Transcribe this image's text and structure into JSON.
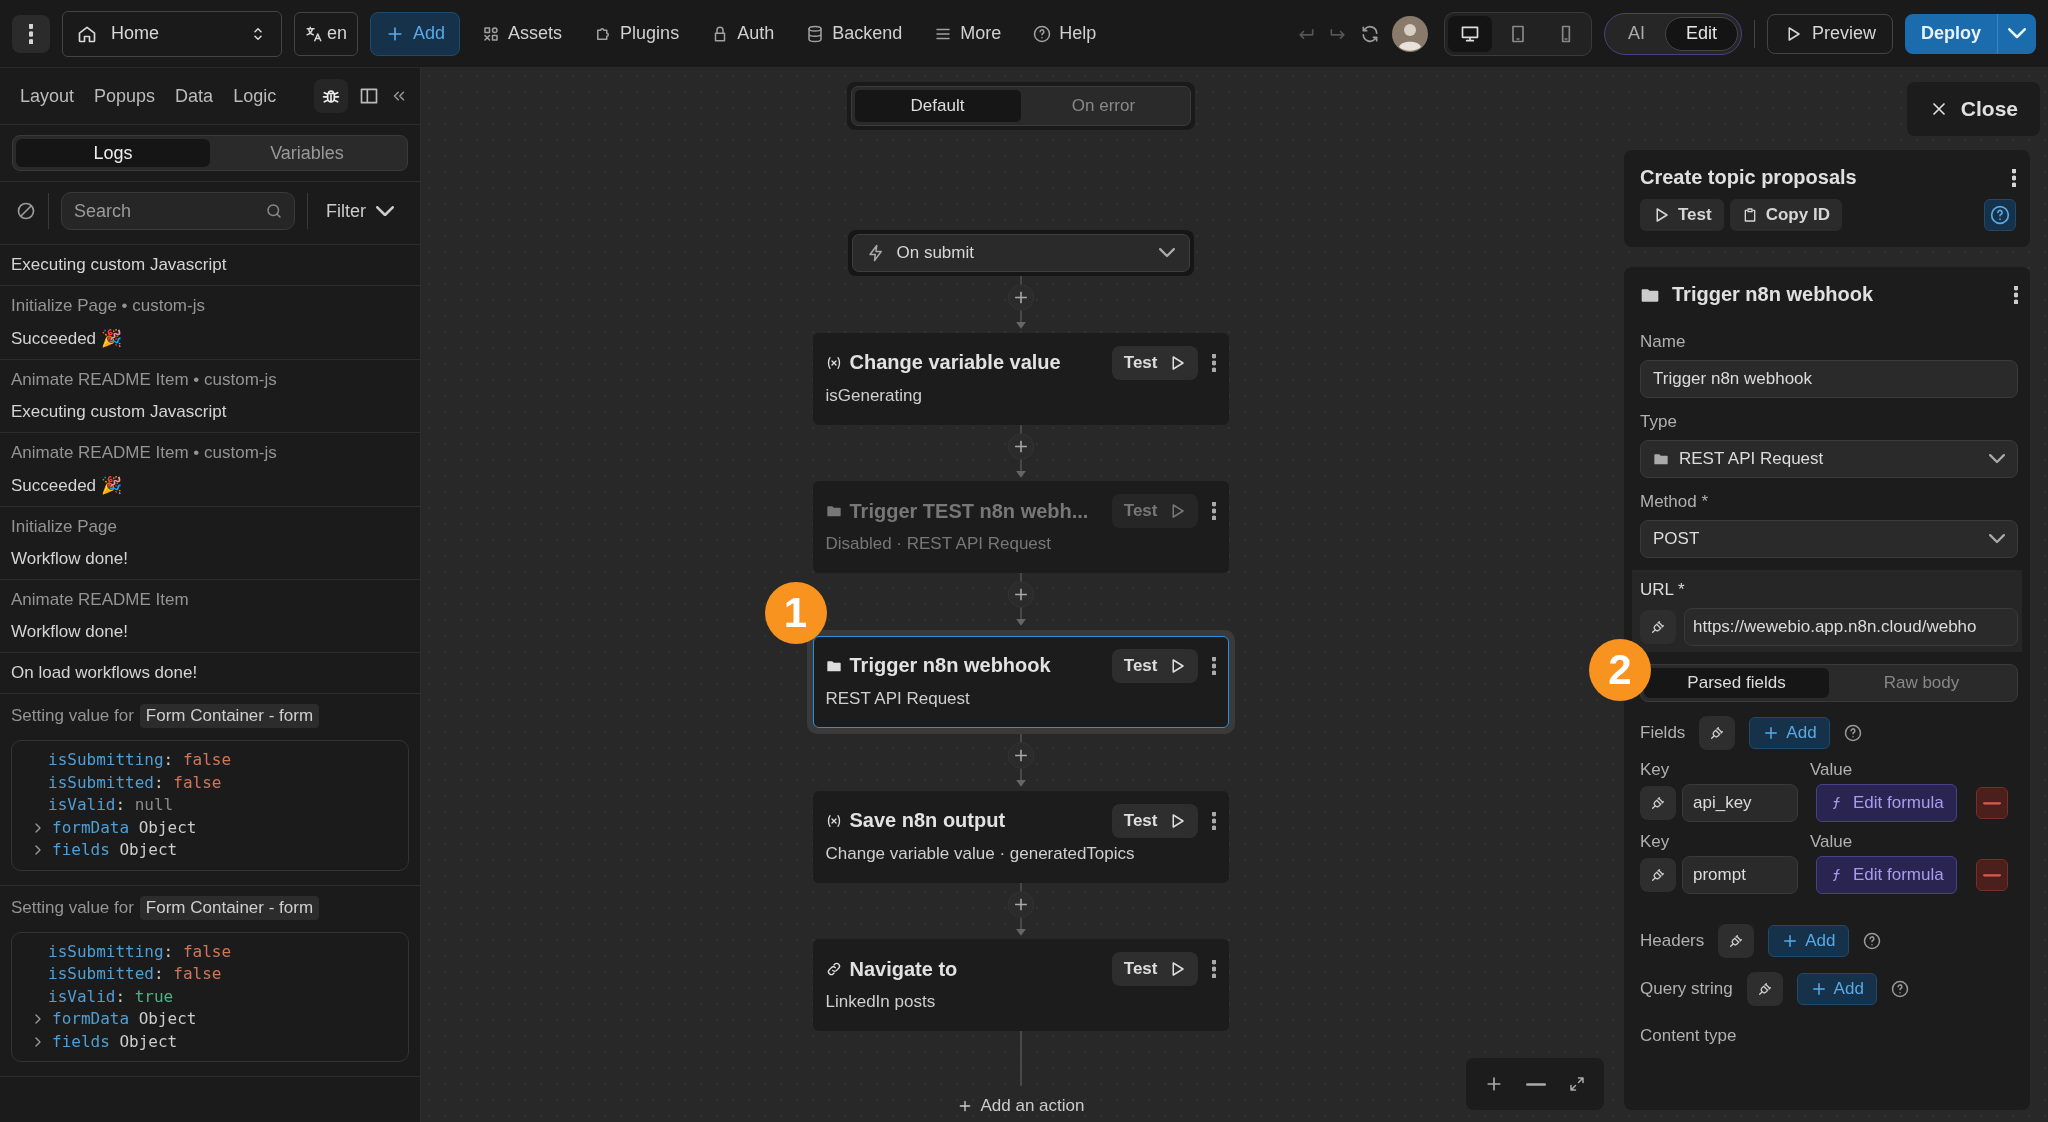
{
  "topbar": {
    "page": "Home",
    "language": "en",
    "add": "Add",
    "nav": [
      {
        "kind": "assets",
        "label": "Assets"
      },
      {
        "kind": "plugins",
        "label": "Plugins"
      },
      {
        "kind": "auth",
        "label": "Auth"
      },
      {
        "kind": "backend",
        "label": "Backend"
      },
      {
        "kind": "more",
        "label": "More"
      },
      {
        "kind": "help",
        "label": "Help"
      }
    ],
    "devices": [
      {
        "kind": "desktop",
        "selected": true
      },
      {
        "kind": "tablet",
        "selected": false
      },
      {
        "kind": "phone",
        "selected": false
      }
    ],
    "modes": [
      {
        "label": "AI",
        "selected": false
      },
      {
        "label": "Edit",
        "selected": true
      }
    ],
    "preview": "Preview",
    "deploy": "Deploy"
  },
  "left_panel": {
    "tabs": [
      "Layout",
      "Popups",
      "Data",
      "Logic"
    ],
    "tools": [
      {
        "kind": "debug",
        "selected": true
      },
      {
        "kind": "sidebar",
        "selected": false
      }
    ],
    "views": [
      {
        "label": "Logs",
        "selected": true
      },
      {
        "label": "Variables",
        "selected": false
      }
    ],
    "search": {
      "placeholder": "Search"
    },
    "filter": "Filter",
    "logs": [
      {
        "kind": "message",
        "message": "Executing custom Javascript"
      },
      {
        "kind": "message",
        "source": "Initialize Page • custom-js",
        "message": "Succeeded 🎉"
      },
      {
        "kind": "message",
        "source": "Animate README Item • custom-js",
        "message": "Executing custom Javascript"
      },
      {
        "kind": "message",
        "source": "Animate README Item • custom-js",
        "message": "Succeeded 🎉"
      },
      {
        "kind": "message",
        "source": "Initialize Page",
        "message": "Workflow done!"
      },
      {
        "kind": "message",
        "source": "Animate README Item",
        "message": "Workflow done!"
      },
      {
        "kind": "message",
        "message": "On load workflows done!"
      },
      {
        "kind": "value",
        "label": "Setting value for",
        "tag": "Form Container - form",
        "lines": [
          {
            "kind": "prop",
            "key": "isSubmitting",
            "sep": ":",
            "value": "false",
            "color": "#d0765b"
          },
          {
            "kind": "prop",
            "key": "isSubmitted",
            "sep": ":",
            "value": "false",
            "color": "#d0765b"
          },
          {
            "kind": "prop",
            "key": "isValid",
            "sep": ":",
            "value": "null",
            "color": "#8a8a8a"
          },
          {
            "kind": "object",
            "key": "formData",
            "value": "Object"
          },
          {
            "kind": "object",
            "key": "fields",
            "value": "Object"
          }
        ]
      },
      {
        "kind": "value",
        "label": "Setting value for",
        "tag": "Form Container - form",
        "lines": [
          {
            "kind": "prop",
            "key": "isSubmitting",
            "sep": ":",
            "value": "false",
            "color": "#d0765b"
          },
          {
            "kind": "prop",
            "key": "isSubmitted",
            "sep": ":",
            "value": "false",
            "color": "#d0765b"
          },
          {
            "kind": "prop",
            "key": "isValid",
            "sep": ":",
            "value": "true",
            "color": "#4fb08a"
          },
          {
            "kind": "object",
            "key": "formData",
            "value": "Object"
          },
          {
            "kind": "object",
            "key": "fields",
            "value": "Object"
          }
        ]
      }
    ]
  },
  "canvas": {
    "branches": [
      {
        "label": "Default",
        "selected": true
      },
      {
        "label": "On error",
        "selected": false
      }
    ],
    "trigger": "On submit",
    "actions": [
      {
        "kind": "variable",
        "title": "Change variable value",
        "subtitle": "isGenerating",
        "test": "Test",
        "disabled": false,
        "selected": false
      },
      {
        "kind": "request",
        "title": "Trigger TEST n8n webh...",
        "subtitle": "Disabled · REST API Request",
        "test": "Test",
        "disabled": true,
        "selected": false
      },
      {
        "kind": "request",
        "title": "Trigger n8n webhook",
        "subtitle": "REST API Request",
        "test": "Test",
        "disabled": false,
        "selected": true,
        "callout": "1"
      },
      {
        "kind": "variable",
        "title": "Save n8n output",
        "subtitle": "Change variable value · generatedTopics",
        "test": "Test",
        "disabled": false,
        "selected": false
      },
      {
        "kind": "link",
        "title": "Navigate to",
        "subtitle": "LinkedIn posts",
        "test": "Test",
        "disabled": false,
        "selected": false
      }
    ],
    "add_action": "Add an action"
  },
  "right_panel": {
    "close": "Close",
    "workflow": {
      "title": "Create topic proposals",
      "test": "Test",
      "copy": "Copy ID"
    },
    "action": {
      "title": "Trigger n8n webhook",
      "name_label": "Name",
      "name": "Trigger n8n webhook",
      "type_label": "Type",
      "type": "REST API Request",
      "method_label": "Method *",
      "method": "POST",
      "url_label": "URL *",
      "url": "https://wewebio.app.n8n.cloud/webho",
      "callout": "2",
      "body_tabs": [
        {
          "label": "Parsed fields",
          "selected": true
        },
        {
          "label": "Raw body",
          "selected": false
        }
      ],
      "fields": {
        "label": "Fields",
        "add": "Add",
        "rows": [
          {
            "key_label": "Key",
            "value_label": "Value",
            "key": "api_key",
            "value": "Edit formula"
          },
          {
            "key_label": "Key",
            "value_label": "Value",
            "key": "prompt",
            "value": "Edit formula"
          }
        ]
      },
      "headers": {
        "label": "Headers",
        "add": "Add"
      },
      "query": {
        "label": "Query string",
        "add": "Add"
      },
      "content_type_label": "Content type"
    }
  }
}
